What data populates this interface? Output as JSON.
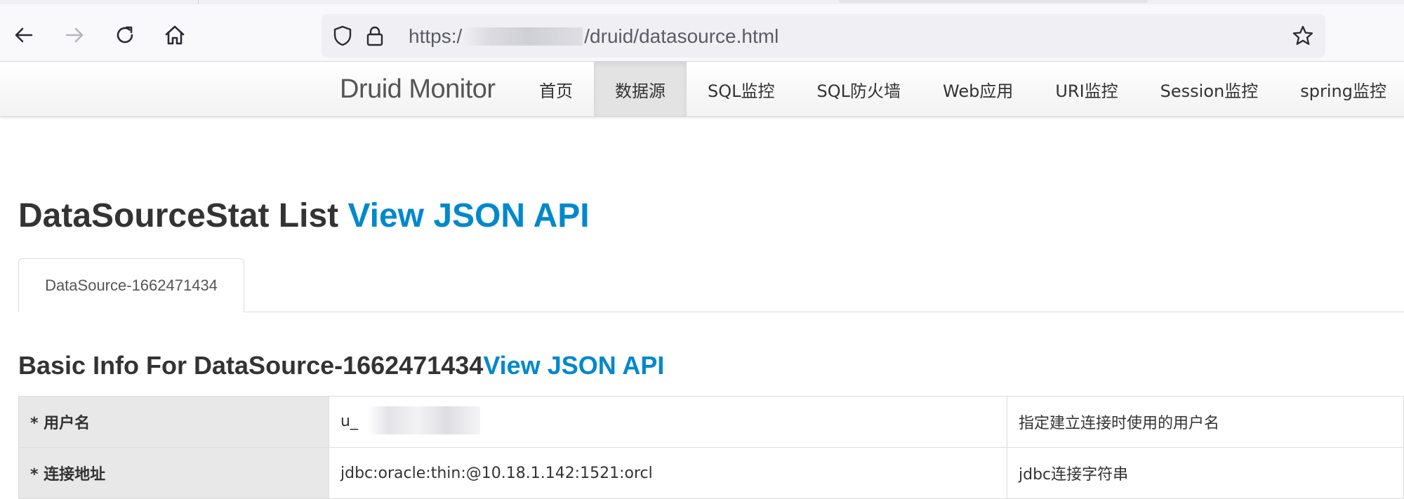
{
  "browser": {
    "url_scheme": "https:/",
    "url_path": "/druid/datasource.html",
    "icons": [
      "back-arrow-icon",
      "forward-arrow-icon",
      "reload-icon",
      "home-icon",
      "shield-icon",
      "lock-icon",
      "star-icon"
    ]
  },
  "navbar": {
    "brand": "Druid Monitor",
    "items": [
      {
        "label": "首页"
      },
      {
        "label": "数据源"
      },
      {
        "label": "SQL监控"
      },
      {
        "label": "SQL防火墙"
      },
      {
        "label": "Web应用"
      },
      {
        "label": "URI监控"
      },
      {
        "label": "Session监控"
      },
      {
        "label": "spring监控"
      }
    ],
    "active_index": 1
  },
  "page": {
    "title": "DataSourceStat List",
    "title_link": "View JSON API",
    "datasource_tab": "DataSource-1662471434",
    "section_title": "Basic Info For DataSource-1662471434",
    "section_link": "View JSON API"
  },
  "table": {
    "rows": [
      {
        "label": "* 用户名",
        "value": "u_",
        "description": "指定建立连接时使用的用户名"
      },
      {
        "label": "* 连接地址",
        "value": "jdbc:oracle:thin:@10.18.1.142:1521:orcl",
        "description": "jdbc连接字符串"
      }
    ]
  },
  "colors": {
    "link": "#0088cc",
    "text": "#333333",
    "active_nav_bg": "#e3e3e3",
    "label_cell_bg": "#e8e8e8"
  }
}
